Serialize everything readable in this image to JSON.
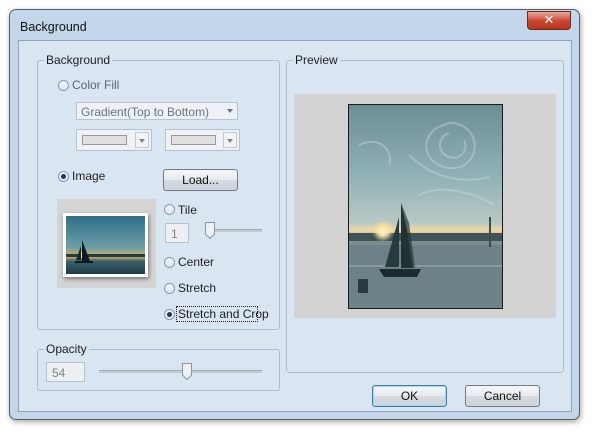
{
  "window": {
    "title": "Background"
  },
  "background_group": {
    "label": "Background",
    "color_fill_label": "Color Fill",
    "gradient_selected": "Gradient(Top to Bottom)",
    "image_label": "Image",
    "load_button": "Load...",
    "tile_label": "Tile",
    "tile_value": "1",
    "center_label": "Center",
    "stretch_label": "Stretch",
    "stretch_crop_label": "Stretch and Crop",
    "selected_mode": "Stretch and Crop",
    "selected_fill": "Image"
  },
  "opacity_group": {
    "label": "Opacity",
    "value": "54"
  },
  "preview_group": {
    "label": "Preview"
  },
  "footer": {
    "ok_label": "OK",
    "cancel_label": "Cancel"
  },
  "icons": {
    "close": "close-icon",
    "dropdown": "chevron-down-icon"
  },
  "colors": {
    "window_frame": "#c4d6ea",
    "client_bg": "#dae5f2",
    "close_button": "#c9452f",
    "preview_bg": "#d3d3d3"
  }
}
